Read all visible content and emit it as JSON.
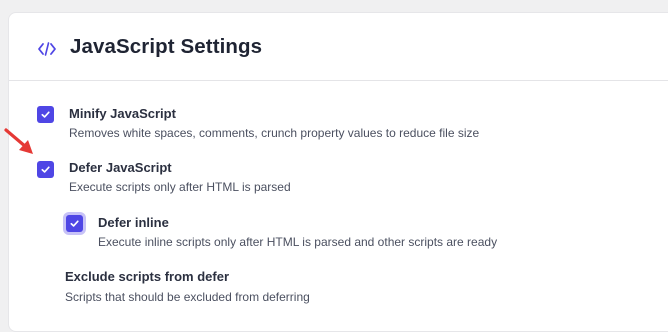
{
  "header": {
    "title": "JavaScript Settings",
    "icon": "code-icon",
    "accent": "#4f46e5"
  },
  "options": [
    {
      "label": "Minify JavaScript",
      "description": "Removes white spaces, comments, crunch property values to reduce file size",
      "checked": true
    },
    {
      "label": "Defer JavaScript",
      "description": "Execute scripts only after HTML is parsed",
      "checked": true
    },
    {
      "label": "Defer inline",
      "description": "Execute inline scripts only after HTML is parsed and other scripts are ready",
      "checked": true
    }
  ],
  "exclude": {
    "label": "Exclude scripts from defer",
    "description": "Scripts that should be excluded from deferring"
  },
  "annotation": {
    "icon": "red-arrow-icon",
    "color": "#e53935"
  }
}
